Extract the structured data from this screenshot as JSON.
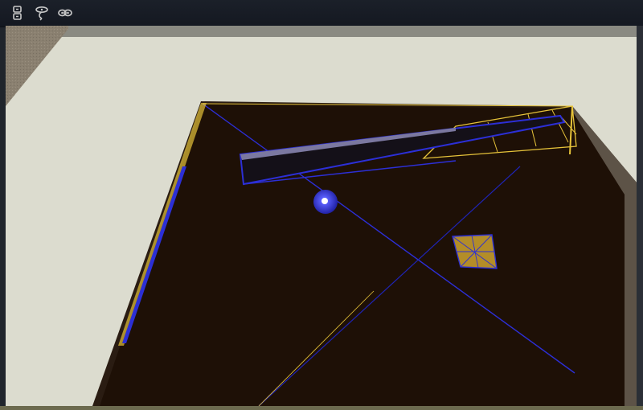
{
  "toolbar": {
    "tools": [
      {
        "name": "view-tool-1",
        "icon": "stacked-boxes-icon"
      },
      {
        "name": "view-tool-2",
        "icon": "orbit-arrow-icon"
      },
      {
        "name": "view-tool-3",
        "icon": "loop-link-icon"
      }
    ]
  },
  "viewport": {
    "colors": {
      "backdrop": "#dcdccf",
      "floor": "#1e1006",
      "wall": "#8a8070",
      "wireframe_yellow": "#e6c33a",
      "wireframe_blue": "#2c2fd6"
    }
  }
}
